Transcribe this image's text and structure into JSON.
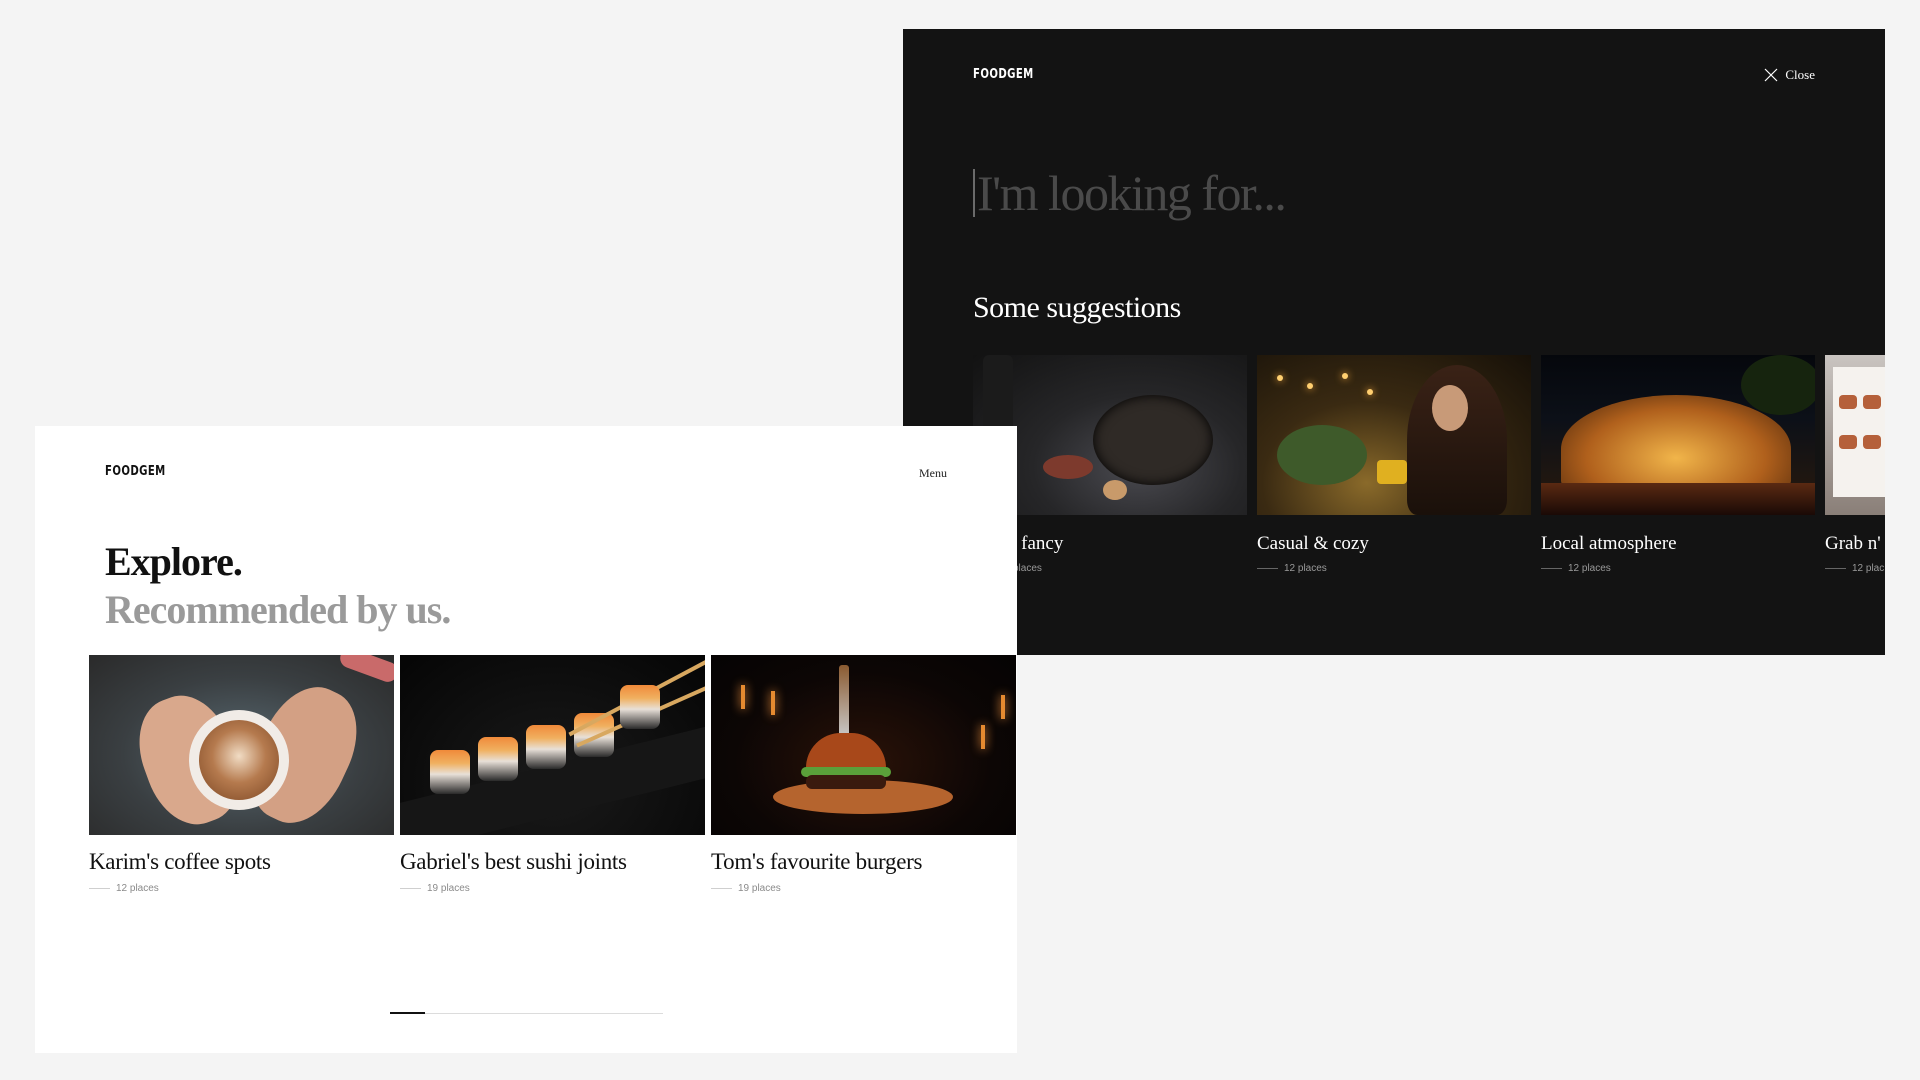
{
  "search_overlay": {
    "logo": "FOODGEM",
    "close_label": "Close",
    "search_placeholder": "I'm looking for...",
    "suggestions_heading": "Some suggestions",
    "suggestions": [
      {
        "title": "' fancy",
        "count": "places",
        "image": "fancy-dinner-photo"
      },
      {
        "title": "Casual & cozy",
        "count": "12 places",
        "image": "cozy-cafe-photo"
      },
      {
        "title": "Local atmosphere",
        "count": "12 places",
        "image": "lit-building-night-photo"
      },
      {
        "title": "Grab n'",
        "count": "12 plac",
        "image": "boxed-food-photo"
      }
    ]
  },
  "explore": {
    "logo": "FOODGEM",
    "menu_label": "Menu",
    "title": "Explore.",
    "subtitle": "Recommended by us.",
    "collections": [
      {
        "title": "Karim's coffee spots",
        "count": "12 places",
        "image": "latte-art-photo"
      },
      {
        "title": "Gabriel's best sushi joints",
        "count": "19 places",
        "image": "sushi-rolls-photo"
      },
      {
        "title": "Tom's favourite burgers",
        "count": "19 places",
        "image": "burger-photo"
      }
    ],
    "slider": {
      "position": 0.0
    }
  },
  "colors": {
    "background": "#f4f4f4",
    "dark_panel": "#131313",
    "light_panel": "#ffffff",
    "muted_text": "#9a9a9a"
  }
}
